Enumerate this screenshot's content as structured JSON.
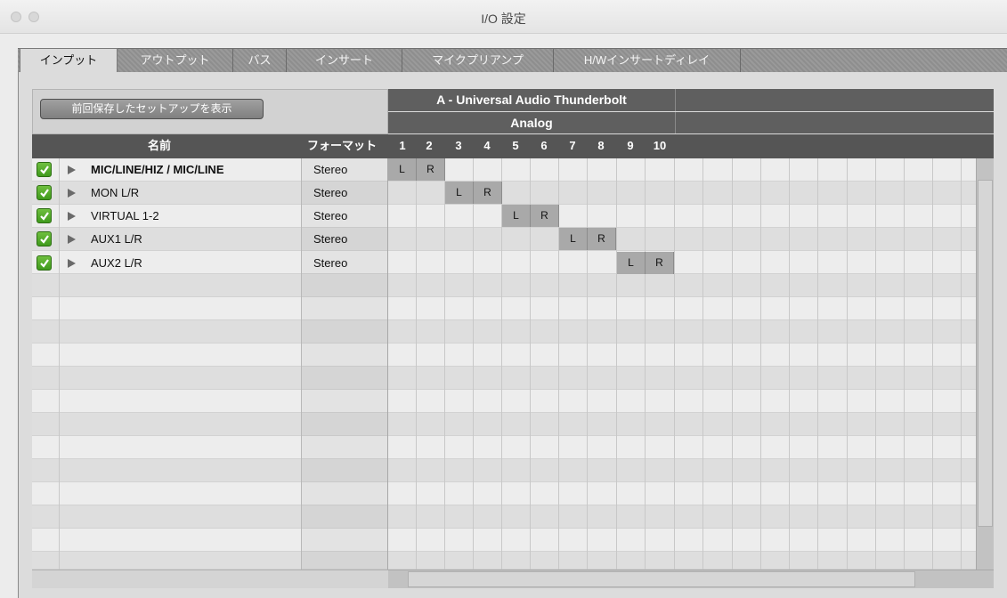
{
  "window": {
    "title": "I/O 設定"
  },
  "tabs": [
    {
      "label": "インプット",
      "active": true
    },
    {
      "label": "アウトプット"
    },
    {
      "label": "バス"
    },
    {
      "label": "インサート"
    },
    {
      "label": "マイクプリアンプ"
    },
    {
      "label": "H/Wインサートディレイ"
    }
  ],
  "toolbar": {
    "show_last_setup_label": "前回保存したセットアップを表示"
  },
  "device": {
    "name": "A - Universal Audio Thunderbolt",
    "group": "Analog"
  },
  "columns": {
    "name": "名前",
    "format": "フォーマット",
    "channels": [
      "1",
      "2",
      "3",
      "4",
      "5",
      "6",
      "7",
      "8",
      "9",
      "10"
    ]
  },
  "rows": [
    {
      "checked": true,
      "name": "MIC/LINE/HIZ / MIC/LINE",
      "bold": true,
      "format": "Stereo",
      "L": "L",
      "R": "R"
    },
    {
      "checked": true,
      "name": "MON L/R",
      "format": "Stereo",
      "L": "L",
      "R": "R"
    },
    {
      "checked": true,
      "name": "VIRTUAL 1-2",
      "format": "Stereo",
      "L": "L",
      "R": "R"
    },
    {
      "checked": true,
      "name": "AUX1 L/R",
      "format": "Stereo",
      "L": "L",
      "R": "R"
    },
    {
      "checked": true,
      "name": "AUX2 L/R",
      "format": "Stereo",
      "L": "L",
      "R": "R"
    }
  ],
  "colors": {
    "accent_check": "#4aa524",
    "header_dark": "#5f5f5f",
    "cell_assigned": "#a9a9a9"
  }
}
